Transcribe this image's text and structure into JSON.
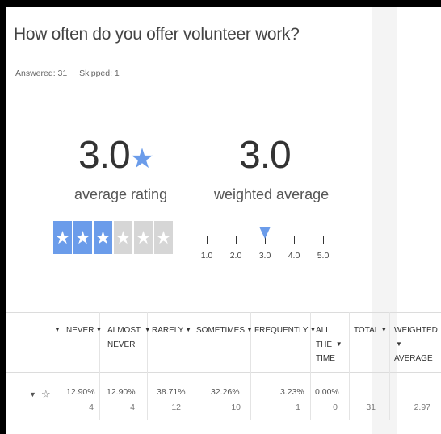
{
  "question": {
    "title": "How often do you offer volunteer work?",
    "answered": "Answered: 31",
    "skipped": "Skipped: 1"
  },
  "summary": {
    "average_value": "3.0",
    "average_label": "average rating",
    "weighted_value": "3.0",
    "weighted_label": "weighted average",
    "star_rating": 3,
    "star_max": 6,
    "weighted_marker_value": 3.0
  },
  "scale": {
    "ticks": [
      "1.0",
      "2.0",
      "3.0",
      "4.0",
      "5.0"
    ]
  },
  "table": {
    "headers": {
      "never": "NEVER",
      "almost_never_1": "ALMOST",
      "almost_never_2": "NEVER",
      "rarely": "RARELY",
      "sometimes": "SOMETIMES",
      "frequently": "FREQUENTLY",
      "all_1": "ALL",
      "all_2": "THE",
      "all_3": "TIME",
      "total": "TOTAL",
      "weighted_1": "WEIGHTED",
      "weighted_2": "AVERAGE"
    },
    "row": {
      "never_pct": "12.90%",
      "never_cnt": "4",
      "almost_pct": "12.90%",
      "almost_cnt": "4",
      "rarely_pct": "38.71%",
      "rarely_cnt": "12",
      "sometimes_pct": "32.26%",
      "sometimes_cnt": "10",
      "frequently_pct": "3.23%",
      "frequently_cnt": "1",
      "all_pct": "0.00%",
      "all_cnt": "0",
      "total": "31",
      "weighted": "2.97"
    }
  },
  "colors": {
    "accent": "#6b9cea",
    "empty_star": "#d6d6d6"
  },
  "icons": {
    "average_star": "star-icon",
    "row_toggle": "chevron-down-icon",
    "row_favorite": "star-outline-icon"
  }
}
